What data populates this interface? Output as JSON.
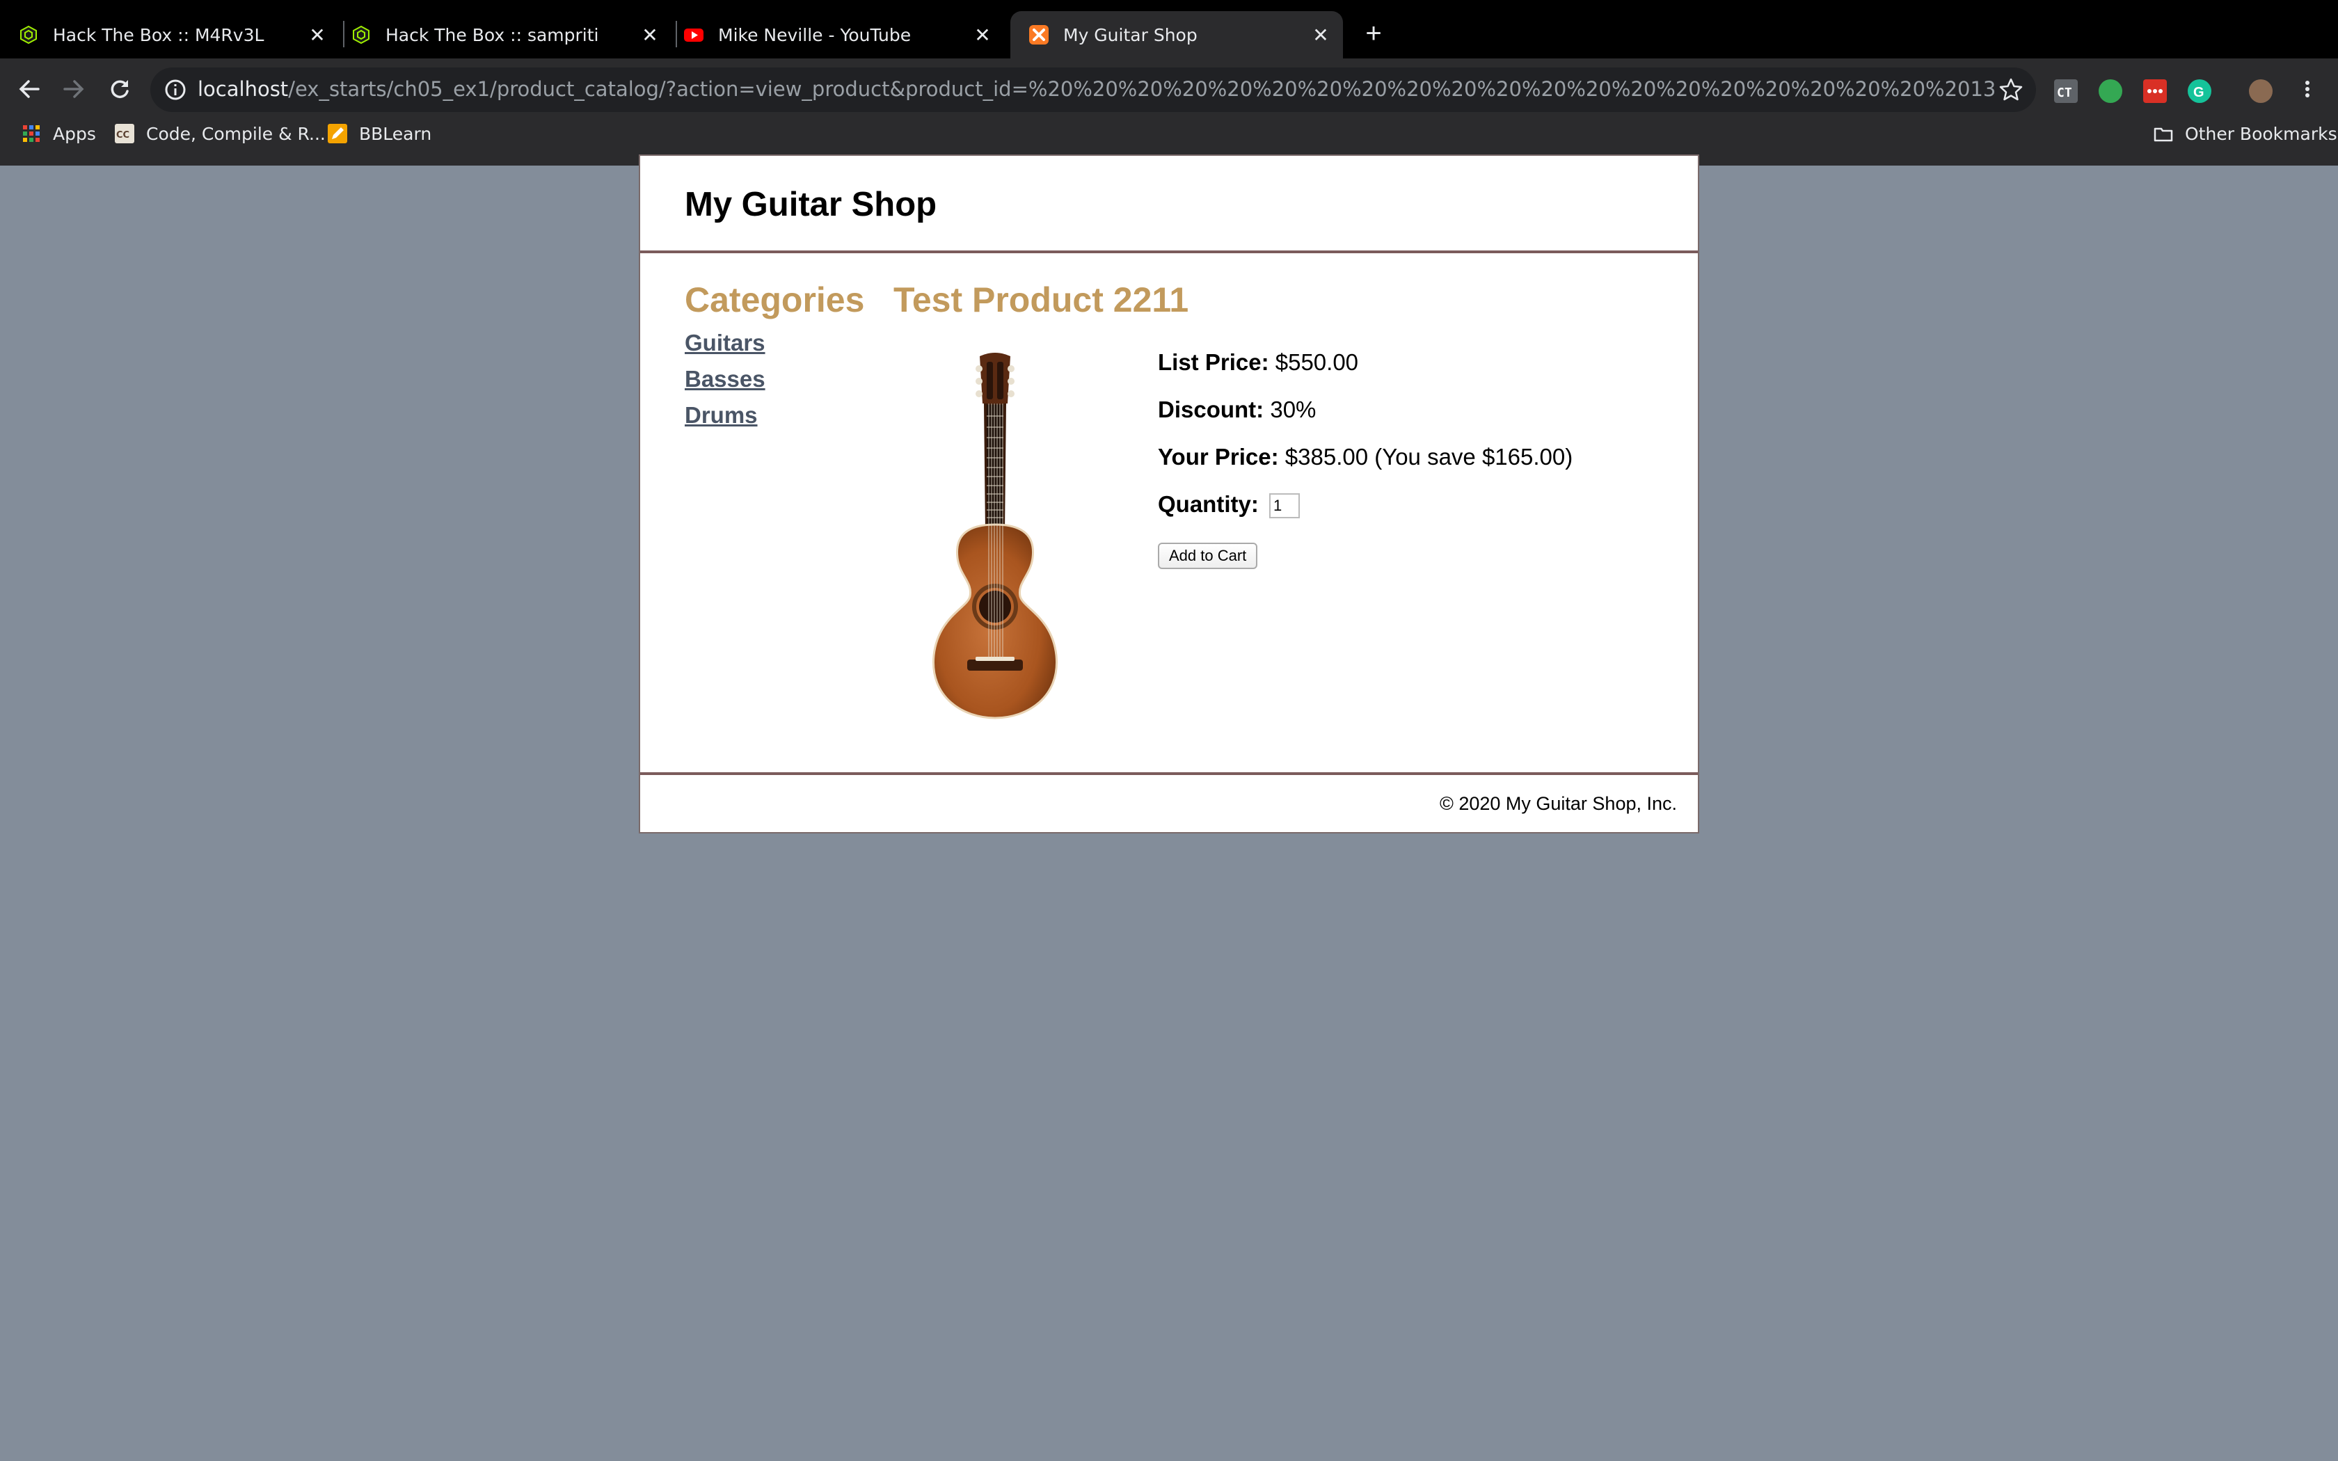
{
  "browser": {
    "tabs": [
      {
        "title": "Hack The Box :: M4Rv3L",
        "favicon": "hackthebox-icon",
        "active": false
      },
      {
        "title": "Hack The Box :: sampriti",
        "favicon": "hackthebox-icon",
        "active": false
      },
      {
        "title": "Mike Neville - YouTube",
        "favicon": "youtube-icon",
        "active": false
      },
      {
        "title": "My Guitar Shop",
        "favicon": "xampp-icon",
        "active": true
      }
    ],
    "close_glyph": "✕",
    "new_tab_glyph": "+",
    "address": {
      "host": "localhost",
      "path": "/ex_starts/ch05_ex1/product_catalog/?action=view_product&product_id=%20%20%20%20%20%20%20%20%20%20%20%20%20%20%20%20%20%20%20%20%2013"
    },
    "bookmarks": [
      {
        "label": "Apps",
        "icon": "apps-grid-icon"
      },
      {
        "label": "Code, Compile & R...",
        "icon": "cc-icon"
      },
      {
        "label": "BBLearn",
        "icon": "pencil-icon"
      }
    ],
    "other_bookmarks": "Other Bookmarks",
    "colors": {
      "tab_bg": "#000000",
      "toolbar_bg": "#2b2b2d"
    }
  },
  "page": {
    "site_title": "My Guitar Shop",
    "categories_heading": "Categories",
    "categories": [
      "Guitars",
      "Basses",
      "Drums"
    ],
    "product": {
      "name": "Test Product 2211",
      "image": "classical-guitar-image",
      "list_price_label": "List Price:",
      "list_price": "$550.00",
      "discount_label": "Discount:",
      "discount": "30%",
      "your_price_label": "Your Price:",
      "your_price": "$385.00 (You save $165.00)",
      "quantity_label": "Quantity:",
      "quantity": "1",
      "add_to_cart": "Add to Cart"
    },
    "footer": "© 2020 My Guitar Shop, Inc.",
    "colors": {
      "background": "#838d9a",
      "heading": "#c29a5c",
      "link": "#4a5566",
      "divider": "#7b5b5b"
    }
  }
}
